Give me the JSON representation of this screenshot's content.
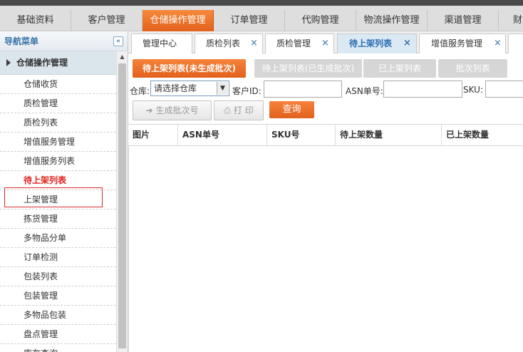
{
  "topnav": [
    {
      "label": "基础资料"
    },
    {
      "label": "客户管理"
    },
    {
      "label": "仓储操作管理"
    },
    {
      "label": "订单管理"
    },
    {
      "label": "代购管理"
    },
    {
      "label": "物流操作管理"
    },
    {
      "label": "渠道管理"
    },
    {
      "label": "财"
    }
  ],
  "sidebar": {
    "title": "导航菜单",
    "collapse_icon": "double-chevron-left-icon",
    "group": "仓储操作管理",
    "items": [
      {
        "label": "仓储收货"
      },
      {
        "label": "质检管理"
      },
      {
        "label": "质检列表"
      },
      {
        "label": "增值服务管理"
      },
      {
        "label": "增值服务列表"
      },
      {
        "label": "待上架列表"
      },
      {
        "label": "上架管理"
      },
      {
        "label": "拣货管理"
      },
      {
        "label": "多物品分单"
      },
      {
        "label": "订单检测"
      },
      {
        "label": "包装列表"
      },
      {
        "label": "包装管理"
      },
      {
        "label": "多物品包装"
      },
      {
        "label": "盘点管理"
      },
      {
        "label": "库存查询"
      }
    ]
  },
  "tabs": [
    {
      "label": "管理中心",
      "close": ""
    },
    {
      "label": "质检列表",
      "close": "×"
    },
    {
      "label": "质检管理",
      "close": "×"
    },
    {
      "label": "待上架列表",
      "close": "×"
    },
    {
      "label": "增值服务管理",
      "close": "×"
    }
  ],
  "subtabs": [
    {
      "label": "待上架列表(未生成批次)"
    },
    {
      "label": "待上架列表(已生成批次)"
    },
    {
      "label": "已上架列表"
    },
    {
      "label": "批次列表"
    }
  ],
  "filter": {
    "warehouse_label": "仓库:",
    "warehouse_value": "请选择仓库",
    "customer_label": "客户ID:",
    "customer_value": "",
    "asn_label": "ASN单号:",
    "asn_value": "",
    "sku_label": "SKU:",
    "sku_value": ""
  },
  "actions": {
    "generate_label": "生成批次号",
    "print_label": "打 印",
    "query_label": "查询"
  },
  "grid": {
    "columns": [
      "图片",
      "ASN单号",
      "SKU号",
      "待上架数量",
      "已上架数量"
    ]
  },
  "colors": {
    "accent": "#e8661f",
    "link": "#3a74a8",
    "current_item": "#e0231c"
  }
}
